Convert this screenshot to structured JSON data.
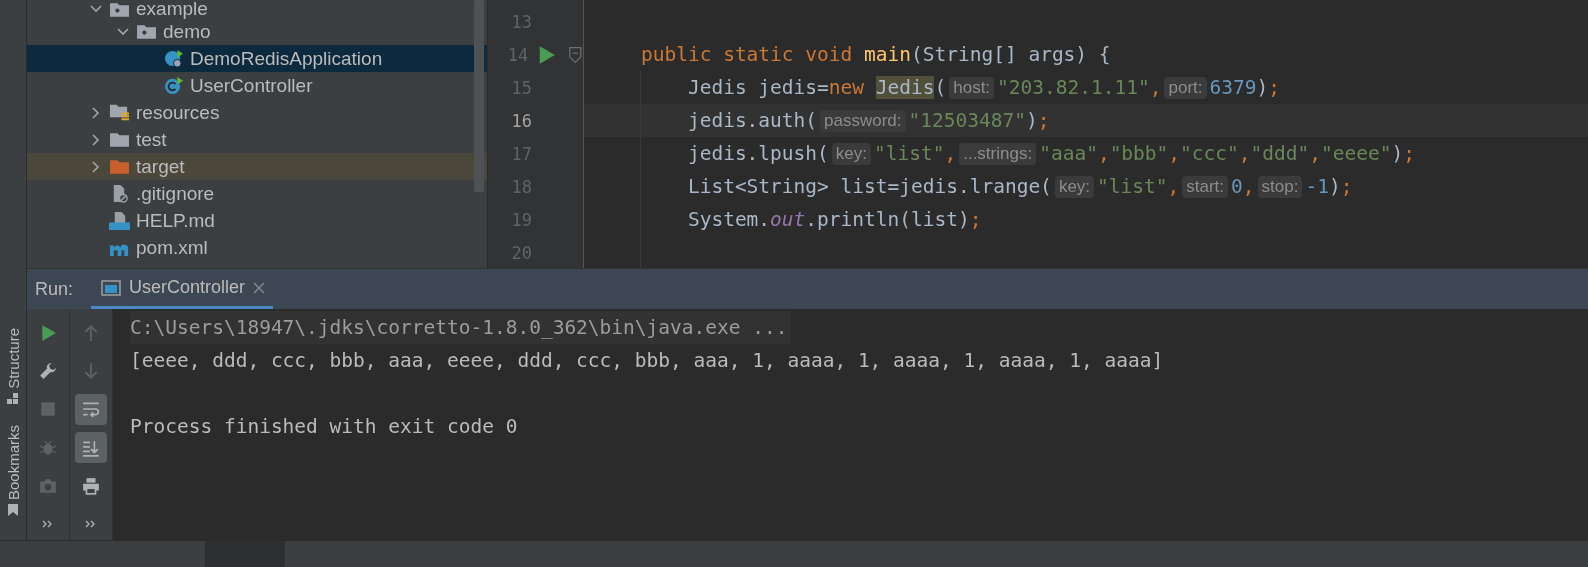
{
  "project_tree": [
    {
      "label": "example",
      "kind": "package",
      "expanded": true,
      "selected": false,
      "children": [
        {
          "label": "demo",
          "kind": "package",
          "expanded": true,
          "selected": false,
          "children": [
            {
              "label": "DemoRedisApplication",
              "kind": "spring-class",
              "selected": true
            },
            {
              "label": "UserController",
              "kind": "class",
              "selected": false
            }
          ]
        }
      ]
    },
    {
      "label": "resources",
      "kind": "resources",
      "expanded": false,
      "selected": false
    },
    {
      "label": "test",
      "kind": "folder",
      "expanded": false,
      "selected": false
    },
    {
      "label": "target",
      "kind": "excluded",
      "expanded": false,
      "selected": false
    },
    {
      "label": ".gitignore",
      "kind": "ignore-file",
      "selected": false
    },
    {
      "label": "HELP.md",
      "kind": "markdown",
      "selected": false
    },
    {
      "label": "pom.xml",
      "kind": "maven",
      "selected": false
    }
  ],
  "editor": {
    "lines": [
      {
        "number": "13",
        "current": false,
        "kind": "plain"
      },
      {
        "number": "14",
        "current": false,
        "kind": "run",
        "tokens": [
          {
            "kind": "kw",
            "text": "    public static void "
          },
          {
            "kind": "fn",
            "text": "main"
          },
          {
            "kind": "plain",
            "text": "(String[] args) {"
          }
        ]
      },
      {
        "number": "15",
        "current": false,
        "kind": "plain",
        "tokens": [
          {
            "kind": "plain",
            "text": "        Jedis jedis="
          },
          {
            "kind": "kw",
            "text": "new "
          },
          {
            "kind": "hl",
            "text": "Jedis"
          },
          {
            "kind": "plain",
            "text": "("
          },
          {
            "kind": "hint",
            "text": "host:"
          },
          {
            "kind": "str",
            "text": "\"203.82.1.11\""
          },
          {
            "kind": "kw",
            "text": ","
          },
          {
            "kind": "hint",
            "text": "port:"
          },
          {
            "kind": "num",
            "text": "6379"
          },
          {
            "kind": "plain",
            "text": ")"
          },
          {
            "kind": "kw",
            "text": ";"
          }
        ]
      },
      {
        "number": "16",
        "current": true,
        "kind": "plain",
        "tokens": [
          {
            "kind": "plain",
            "text": "        jedis.auth("
          },
          {
            "kind": "hint",
            "text": "password:"
          },
          {
            "kind": "str",
            "text": "\"12503487\""
          },
          {
            "kind": "plain",
            "text": ")"
          },
          {
            "kind": "kw",
            "text": ";"
          }
        ]
      },
      {
        "number": "17",
        "current": false,
        "kind": "plain",
        "tokens": [
          {
            "kind": "plain",
            "text": "        jedis.lpush("
          },
          {
            "kind": "hint",
            "text": "key:"
          },
          {
            "kind": "str",
            "text": "\"list\""
          },
          {
            "kind": "kw",
            "text": ","
          },
          {
            "kind": "hint",
            "text": "...strings:"
          },
          {
            "kind": "str",
            "text": "\"aaa\""
          },
          {
            "kind": "kw",
            "text": ","
          },
          {
            "kind": "str",
            "text": "\"bbb\""
          },
          {
            "kind": "kw",
            "text": ","
          },
          {
            "kind": "str",
            "text": "\"ccc\""
          },
          {
            "kind": "kw",
            "text": ","
          },
          {
            "kind": "str",
            "text": "\"ddd\""
          },
          {
            "kind": "kw",
            "text": ","
          },
          {
            "kind": "str",
            "text": "\"eeee\""
          },
          {
            "kind": "plain",
            "text": ")"
          },
          {
            "kind": "kw",
            "text": ";"
          }
        ]
      },
      {
        "number": "18",
        "current": false,
        "kind": "plain",
        "tokens": [
          {
            "kind": "plain",
            "text": "        List<String> list=jedis.lrange("
          },
          {
            "kind": "hint",
            "text": "key:"
          },
          {
            "kind": "str",
            "text": "\"list\""
          },
          {
            "kind": "kw",
            "text": ","
          },
          {
            "kind": "hint",
            "text": "start:"
          },
          {
            "kind": "num",
            "text": "0"
          },
          {
            "kind": "kw",
            "text": ","
          },
          {
            "kind": "hint",
            "text": "stop:"
          },
          {
            "kind": "num",
            "text": "-1"
          },
          {
            "kind": "plain",
            "text": ")"
          },
          {
            "kind": "kw",
            "text": ";"
          }
        ]
      },
      {
        "number": "19",
        "current": false,
        "kind": "plain",
        "tokens": [
          {
            "kind": "plain",
            "text": "        System."
          },
          {
            "kind": "field",
            "text": "out"
          },
          {
            "kind": "plain",
            "text": ".println(list)"
          },
          {
            "kind": "kw",
            "text": ";"
          }
        ]
      },
      {
        "number": "20",
        "current": false,
        "kind": "plain"
      }
    ]
  },
  "side_strip": [
    {
      "label": "Structure",
      "kind": "structure"
    },
    {
      "label": "Bookmarks",
      "kind": "bookmark"
    }
  ],
  "run_panel": {
    "label": "Run:",
    "tabs": [
      {
        "label": "UserController",
        "selected": true
      }
    ],
    "toolbar_left": [
      {
        "kind": "rerun",
        "disabled": false
      },
      {
        "kind": "wrench",
        "disabled": false
      },
      {
        "kind": "stop",
        "disabled": true
      },
      {
        "kind": "bug",
        "disabled": true
      },
      {
        "kind": "camera",
        "disabled": true
      },
      {
        "kind": "more",
        "disabled": false
      }
    ],
    "toolbar_right": [
      {
        "kind": "up",
        "disabled": true
      },
      {
        "kind": "down",
        "disabled": true
      },
      {
        "kind": "wrap",
        "disabled": false,
        "on": true
      },
      {
        "kind": "scroll-end",
        "disabled": false,
        "on": true
      },
      {
        "kind": "print",
        "disabled": false,
        "on": false
      },
      {
        "kind": "more",
        "disabled": false
      }
    ],
    "console": [
      {
        "kind": "command",
        "text": "C:\\Users\\18947\\.jdks\\corretto-1.8.0_362\\bin\\java.exe ..."
      },
      {
        "kind": "output",
        "text": "[eeee, ddd, ccc, bbb, aaa, eeee, ddd, ccc, bbb, aaa, 1, aaaa, 1, aaaa, 1, aaaa, 1, aaaa]"
      },
      {
        "kind": "status",
        "text": "Process finished with exit code 0"
      }
    ]
  }
}
